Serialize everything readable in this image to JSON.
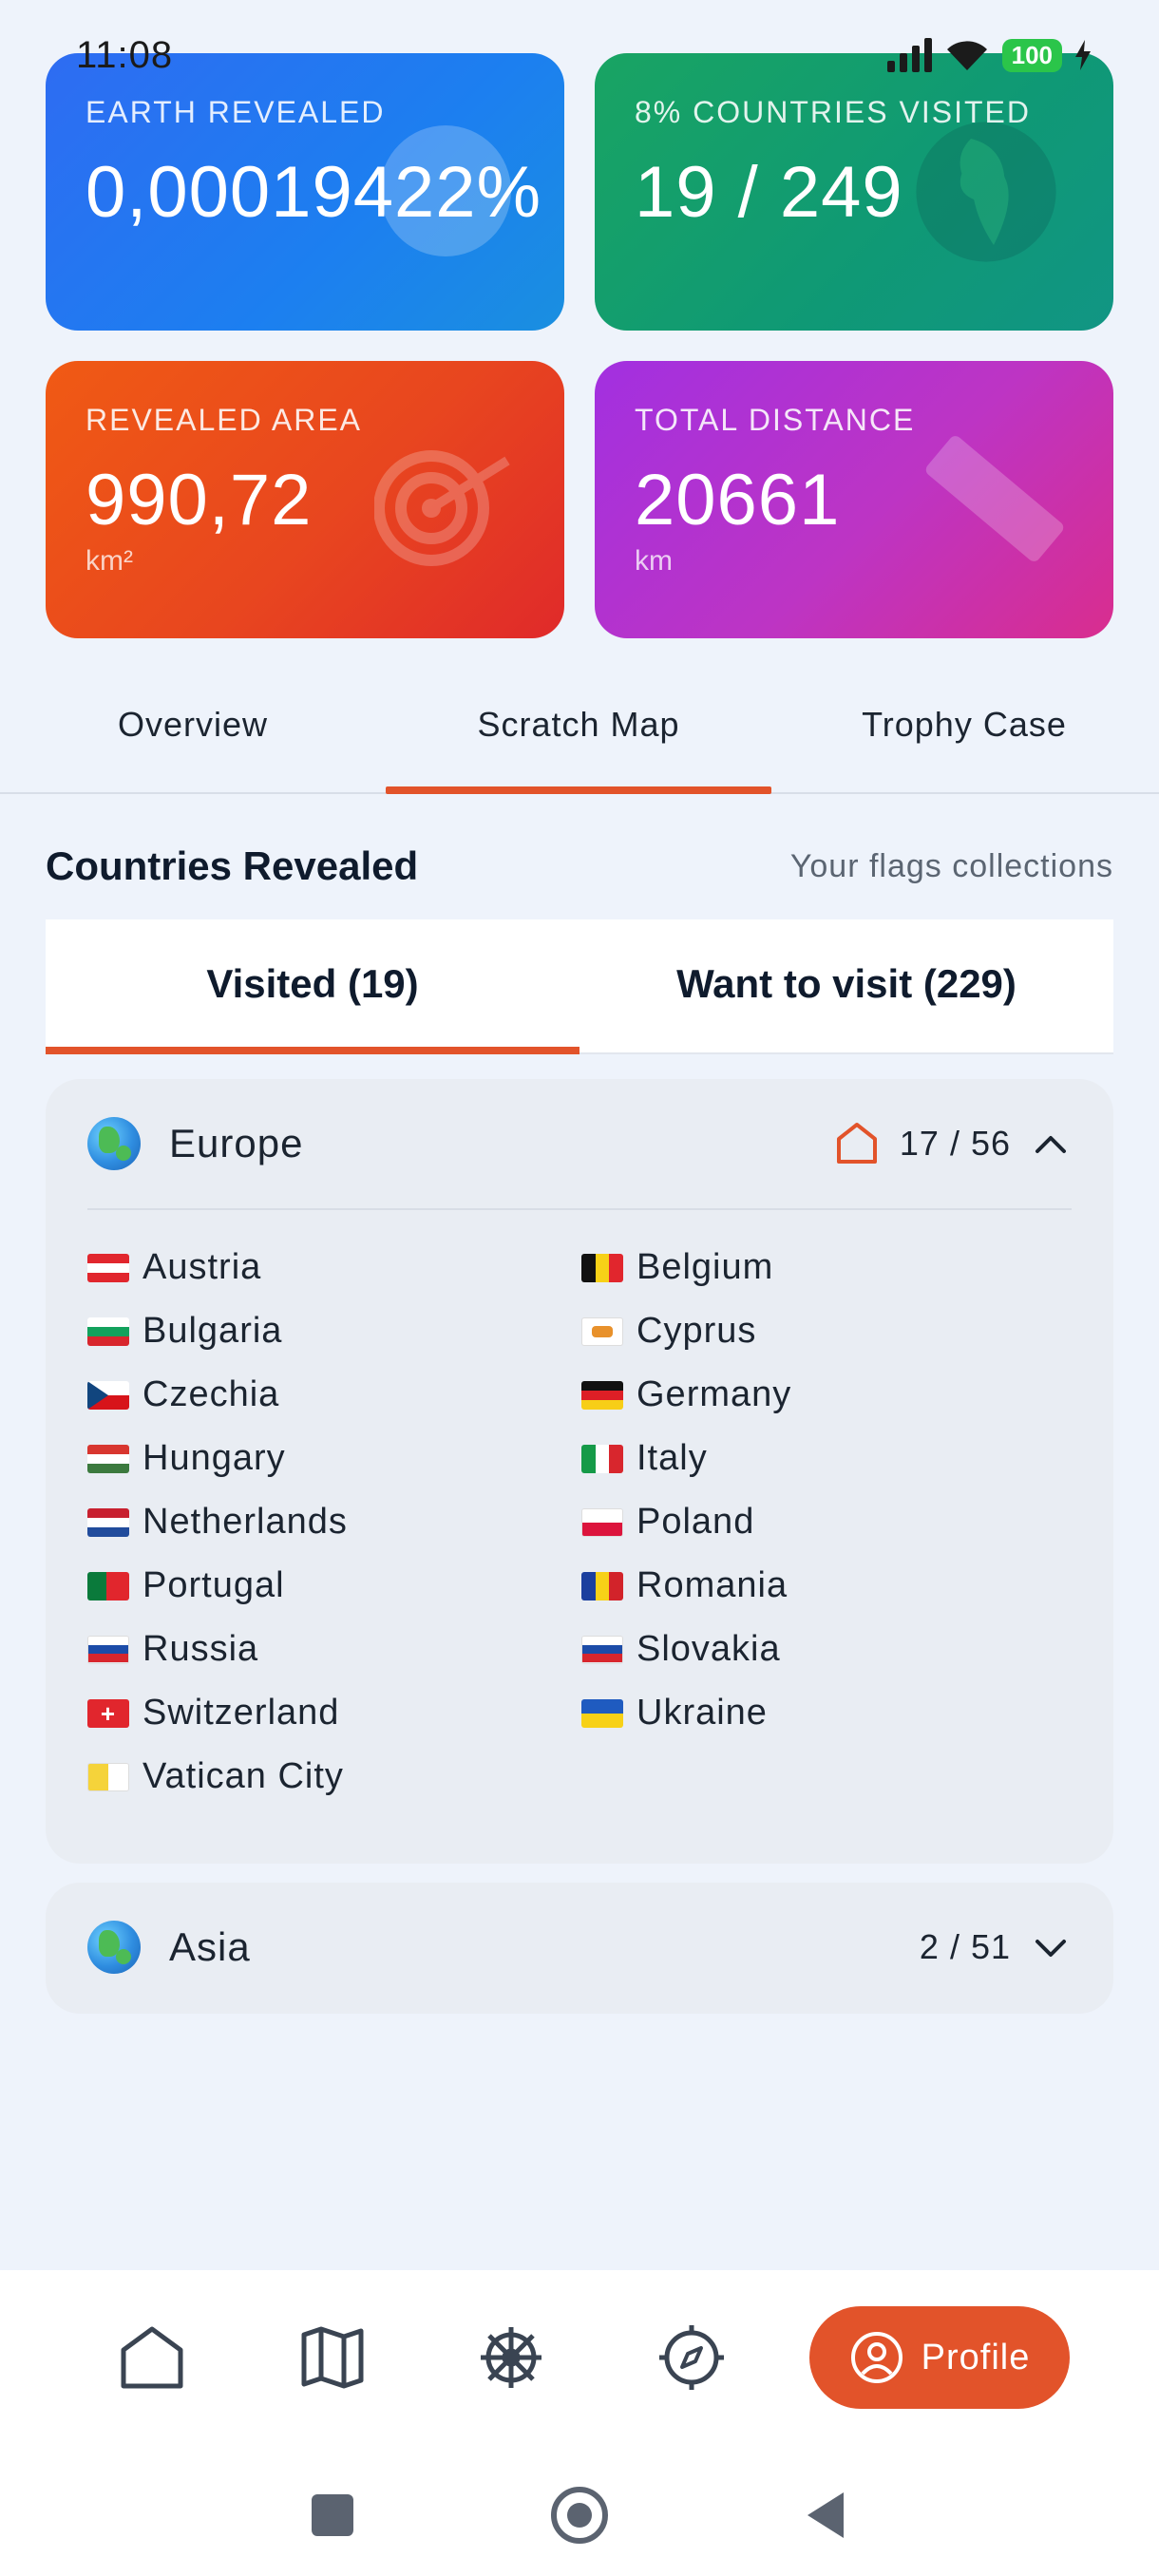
{
  "status": {
    "time": "11:08",
    "battery": "100"
  },
  "cards": {
    "earth": {
      "label": "EARTH REVEALED",
      "value": "0,00019422%"
    },
    "countries": {
      "label": "8% COUNTRIES VISITED",
      "value": "19 / 249"
    },
    "area": {
      "label": "REVEALED AREA",
      "value": "990,72",
      "unit": "km²"
    },
    "distance": {
      "label": "TOTAL DISTANCE",
      "value": "20661",
      "unit": "km"
    }
  },
  "tabs": [
    "Overview",
    "Scratch Map",
    "Trophy Case"
  ],
  "section": {
    "title": "Countries Revealed",
    "subtitle": "Your flags collections"
  },
  "sub_tabs": [
    "Visited (19)",
    "Want to visit (229)"
  ],
  "continents": [
    {
      "name": "Europe",
      "count": "17 / 56",
      "countries": [
        "Austria",
        "Belgium",
        "Bulgaria",
        "Cyprus",
        "Czechia",
        "Germany",
        "Hungary",
        "Italy",
        "Netherlands",
        "Poland",
        "Portugal",
        "Romania",
        "Russia",
        "Slovakia",
        "Switzerland",
        "Ukraine",
        "Vatican City"
      ]
    },
    {
      "name": "Asia",
      "count": "2 / 51"
    }
  ],
  "nav": {
    "profile_label": "Profile"
  },
  "colors": {
    "accent": "#e2532a"
  }
}
